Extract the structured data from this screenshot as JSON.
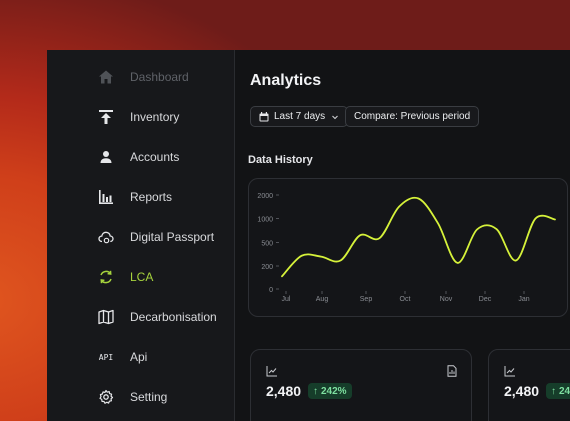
{
  "sidebar": {
    "items": [
      {
        "label": "Dashboard",
        "icon": "home-icon",
        "state": "dim"
      },
      {
        "label": "Inventory",
        "icon": "upload-icon",
        "state": "normal"
      },
      {
        "label": "Accounts",
        "icon": "user-icon",
        "state": "normal"
      },
      {
        "label": "Reports",
        "icon": "bar-chart-icon",
        "state": "normal"
      },
      {
        "label": "Digital Passport",
        "icon": "cloud-passport-icon",
        "state": "normal"
      },
      {
        "label": "LCA",
        "icon": "recycle-icon",
        "state": "active"
      },
      {
        "label": "Decarbonisation",
        "icon": "map-icon",
        "state": "normal"
      },
      {
        "label": "Api",
        "icon": "api-icon",
        "icon_text": "API",
        "state": "normal"
      },
      {
        "label": "Setting",
        "icon": "gear-icon",
        "state": "normal"
      }
    ]
  },
  "header": {
    "title": "Analytics",
    "range_label": "Last 7 days",
    "compare_label": "Compare: Previous period"
  },
  "history": {
    "title": "Data History"
  },
  "chart_data": {
    "type": "line",
    "title": "Data History",
    "xlabel": "",
    "ylabel": "",
    "x_ticks": [
      "Jul",
      "Aug",
      "Sep",
      "Oct",
      "Nov",
      "Dec",
      "Jan"
    ],
    "y_ticks": [
      "0",
      "200",
      "500",
      "1000",
      "2000"
    ],
    "ylim": [
      0,
      2000
    ],
    "grid": false,
    "series": [
      {
        "color": "#d6f23a",
        "points": [
          {
            "x": "Jul",
            "y": 110
          },
          {
            "x": "",
            "y": 330
          },
          {
            "x": "Aug",
            "y": 320
          },
          {
            "x": "",
            "y": 270
          },
          {
            "x": "",
            "y": 650
          },
          {
            "x": "Sep",
            "y": 590
          },
          {
            "x": "",
            "y": 1500
          },
          {
            "x": "Oct",
            "y": 1850
          },
          {
            "x": "",
            "y": 900
          },
          {
            "x": "Nov",
            "y": 240
          },
          {
            "x": "",
            "y": 770
          },
          {
            "x": "Dec",
            "y": 780
          },
          {
            "x": "",
            "y": 270
          },
          {
            "x": "Jan",
            "y": 1000
          },
          {
            "x": "",
            "y": 980
          }
        ]
      }
    ]
  },
  "stats": [
    {
      "value": "2,480",
      "change": "242%"
    },
    {
      "value": "2,480",
      "change": "242%"
    }
  ],
  "colors": {
    "accent": "#a6d33d",
    "line": "#d6f23a",
    "badge_bg": "#163d2a",
    "badge_text": "#7ee0a0"
  }
}
